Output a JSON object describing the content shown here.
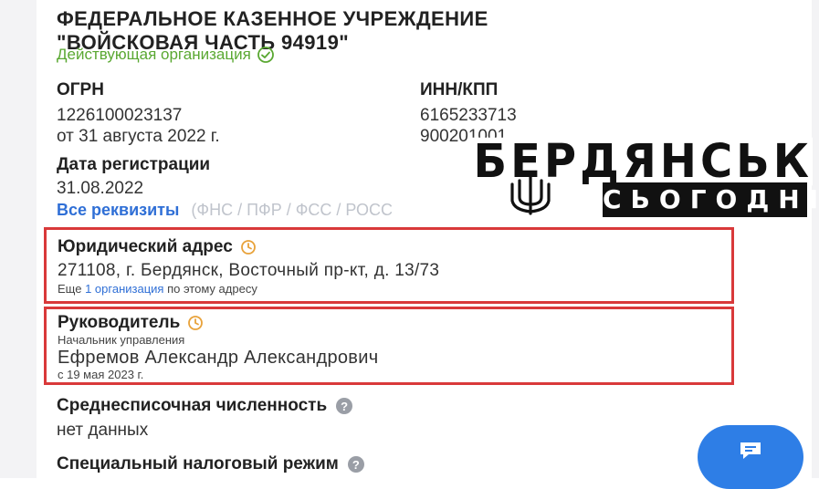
{
  "organization": {
    "name_line1": "ФЕДЕРАЛЬНОЕ КАЗЕННОЕ УЧРЕЖДЕНИЕ",
    "name_line2": "\"ВОЙСКОВАЯ ЧАСТЬ 94919\"",
    "status": "Действующая организация",
    "status_color": "#5aa832"
  },
  "ogrn": {
    "label": "ОГРН",
    "value": "1226100023137",
    "date": "от 31 августа 2022 г."
  },
  "inn_kpp": {
    "label": "ИНН/КПП",
    "inn": "6165233713",
    "kpp": "900201001"
  },
  "registration": {
    "label": "Дата регистрации",
    "value": "31.08.2022"
  },
  "requisites": {
    "link": "Все реквизиты",
    "sources": "(ФНС / ПФР / ФСС / РОСС"
  },
  "legal_address": {
    "title": "Юридический адрес",
    "address": "271108, г. Бердянск, Восточный пр-кт, д. 13/73",
    "more_prefix": "Еще",
    "more_link": "1 организация",
    "more_suffix": "по этому адресу"
  },
  "director": {
    "title": "Руководитель",
    "position": "Начальник управления",
    "name": "Ефремов Александр Александрович",
    "since": "с 19 мая 2023 г."
  },
  "headcount": {
    "title": "Среднесписочная численность",
    "value": "нет данных"
  },
  "tax_regime": {
    "title": "Специальный налоговый режим"
  },
  "watermark": {
    "line1": "БЕРДЯНСЬК",
    "line2": "СЬОГОДНІ"
  },
  "icons": {
    "status": "check-circle-icon",
    "clock": "clock-icon",
    "help": "question-icon",
    "chat": "chat-icon",
    "emblem": "trident-icon"
  },
  "colors": {
    "accent": "#2e7ee6",
    "link": "#2f6fd6",
    "highlight_border": "#d9393a",
    "clock": "#e8a23a"
  }
}
